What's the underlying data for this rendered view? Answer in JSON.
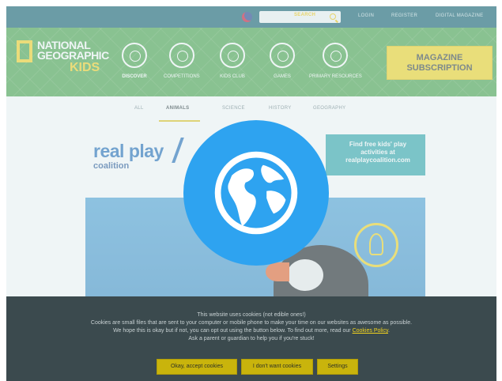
{
  "topbar": {
    "search_label": "SEARCH",
    "links": [
      "LOGIN",
      "REGISTER",
      "DIGITAL MAGAZINE"
    ]
  },
  "header": {
    "logo_line1": "NATIONAL",
    "logo_line2": "GEOGRAPHIC",
    "logo_kids": "KIDS",
    "nav": [
      "DISCOVER",
      "COMPETITIONS",
      "KIDS CLUB",
      "GAMES",
      "PRIMARY RESOURCES"
    ],
    "magazine_line1": "MAGAZINE",
    "magazine_line2": "SUBSCRIPTION"
  },
  "tabs": [
    "ALL",
    "ANIMALS",
    "SCIENCE",
    "HISTORY",
    "GEOGRAPHY"
  ],
  "banner": {
    "real_play": "real play",
    "coalition": "coalition",
    "cta_line1": "Find free kids' play",
    "cta_line2": "activities at",
    "cta_line3": "realplaycoalition.com"
  },
  "cookie": {
    "title": "This website uses cookies (not edible ones!)",
    "line1": "Cookies are small files that are sent to your computer or mobile phone to make your time on our websites as awesome as possible.",
    "line2": "We hope this is okay but if not, you can opt out using the button below. To find out more, read our",
    "policy_link": "Cookies Policy",
    "line3": "Ask a parent or guardian to help you if you're stuck!",
    "accept": "Okay, accept cookies",
    "reject": "I don't want cookies",
    "settings": "Settings"
  },
  "colors": {
    "topbar": "#0f5e6e",
    "header_green": "#46a347",
    "accent_yellow": "#f5d51e",
    "globe_blue": "#2ea3f0",
    "cookie_panel": "#3b4a4e"
  },
  "icons": [
    "flag-icon",
    "search-icon",
    "globe-icon",
    "discover-icon",
    "competitions-icon",
    "kids-club-icon",
    "games-icon",
    "resources-icon"
  ]
}
